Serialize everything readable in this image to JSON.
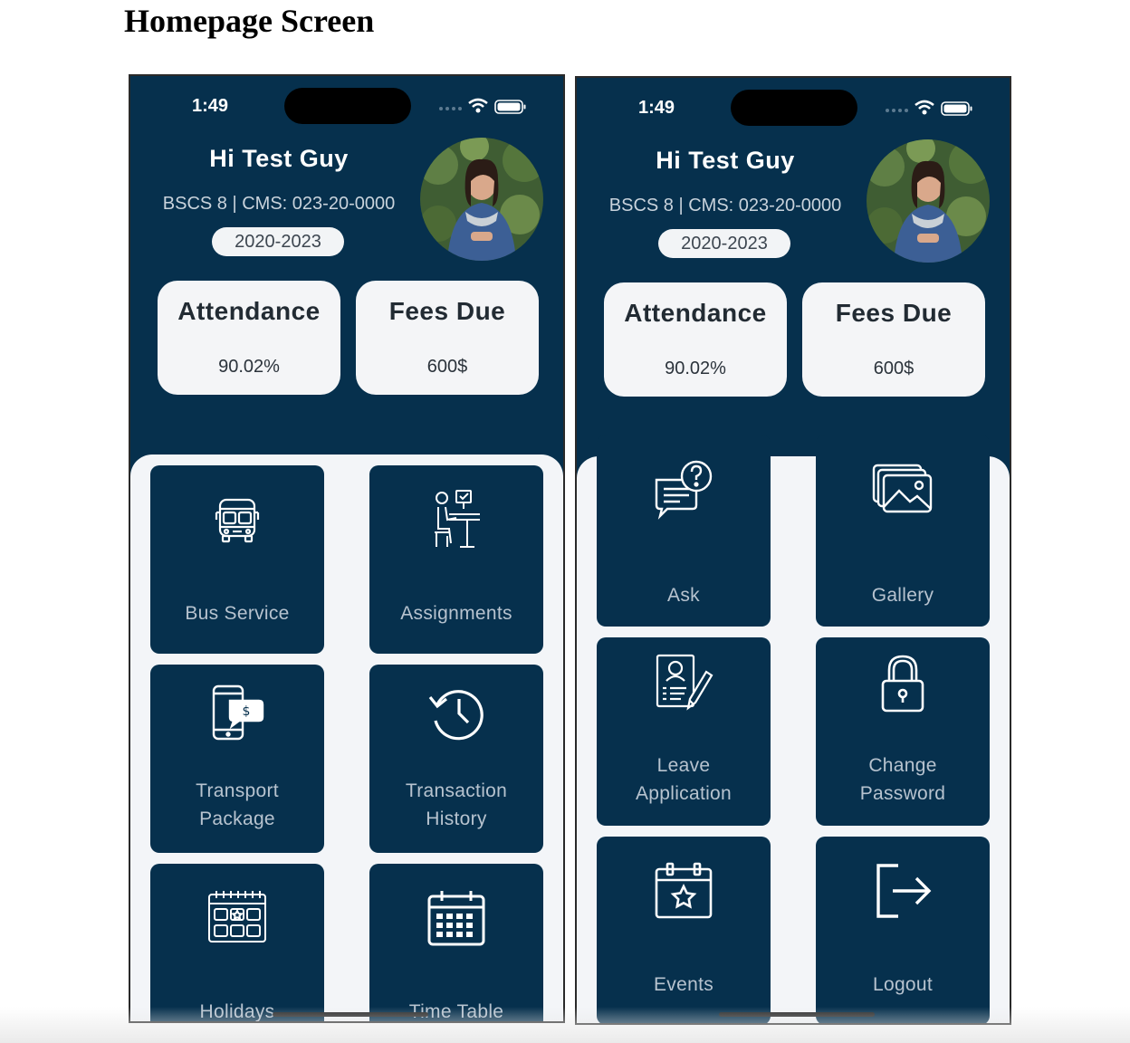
{
  "page": {
    "title": "Homepage Screen"
  },
  "status_bar": {
    "time": "1:49"
  },
  "profile": {
    "greeting": "Hi Test Guy",
    "info": "BSCS 8 | CMS: 023-20-0000",
    "session": "2020-2023"
  },
  "stats": {
    "attendance": {
      "label": "Attendance",
      "value": "90.02%"
    },
    "fees": {
      "label": "Fees Due",
      "value": "600$"
    }
  },
  "colors": {
    "primary": "#06304d",
    "tile_text": "#b7c3cf",
    "card_bg": "#f4f5f7",
    "grid_bg": "#f3f5f8"
  },
  "screen1_tiles": [
    {
      "label": "Bus Service",
      "icon": "bus-icon"
    },
    {
      "label": "Assignments",
      "icon": "assignment-desk-icon"
    },
    {
      "label": "Transport Package",
      "icon": "phone-payment-icon"
    },
    {
      "label": "Transaction History",
      "icon": "history-icon"
    },
    {
      "label": "Holidays",
      "icon": "holiday-calendar-icon"
    },
    {
      "label": "Time Table",
      "icon": "timetable-calendar-icon"
    }
  ],
  "screen2_tiles": [
    {
      "label": "Ask",
      "icon": "question-chat-icon"
    },
    {
      "label": "Gallery",
      "icon": "gallery-icon"
    },
    {
      "label": "Leave Application",
      "icon": "application-form-icon"
    },
    {
      "label": "Change Password",
      "icon": "lock-icon"
    },
    {
      "label": "Events",
      "icon": "event-calendar-icon"
    },
    {
      "label": "Logout",
      "icon": "logout-icon"
    }
  ]
}
